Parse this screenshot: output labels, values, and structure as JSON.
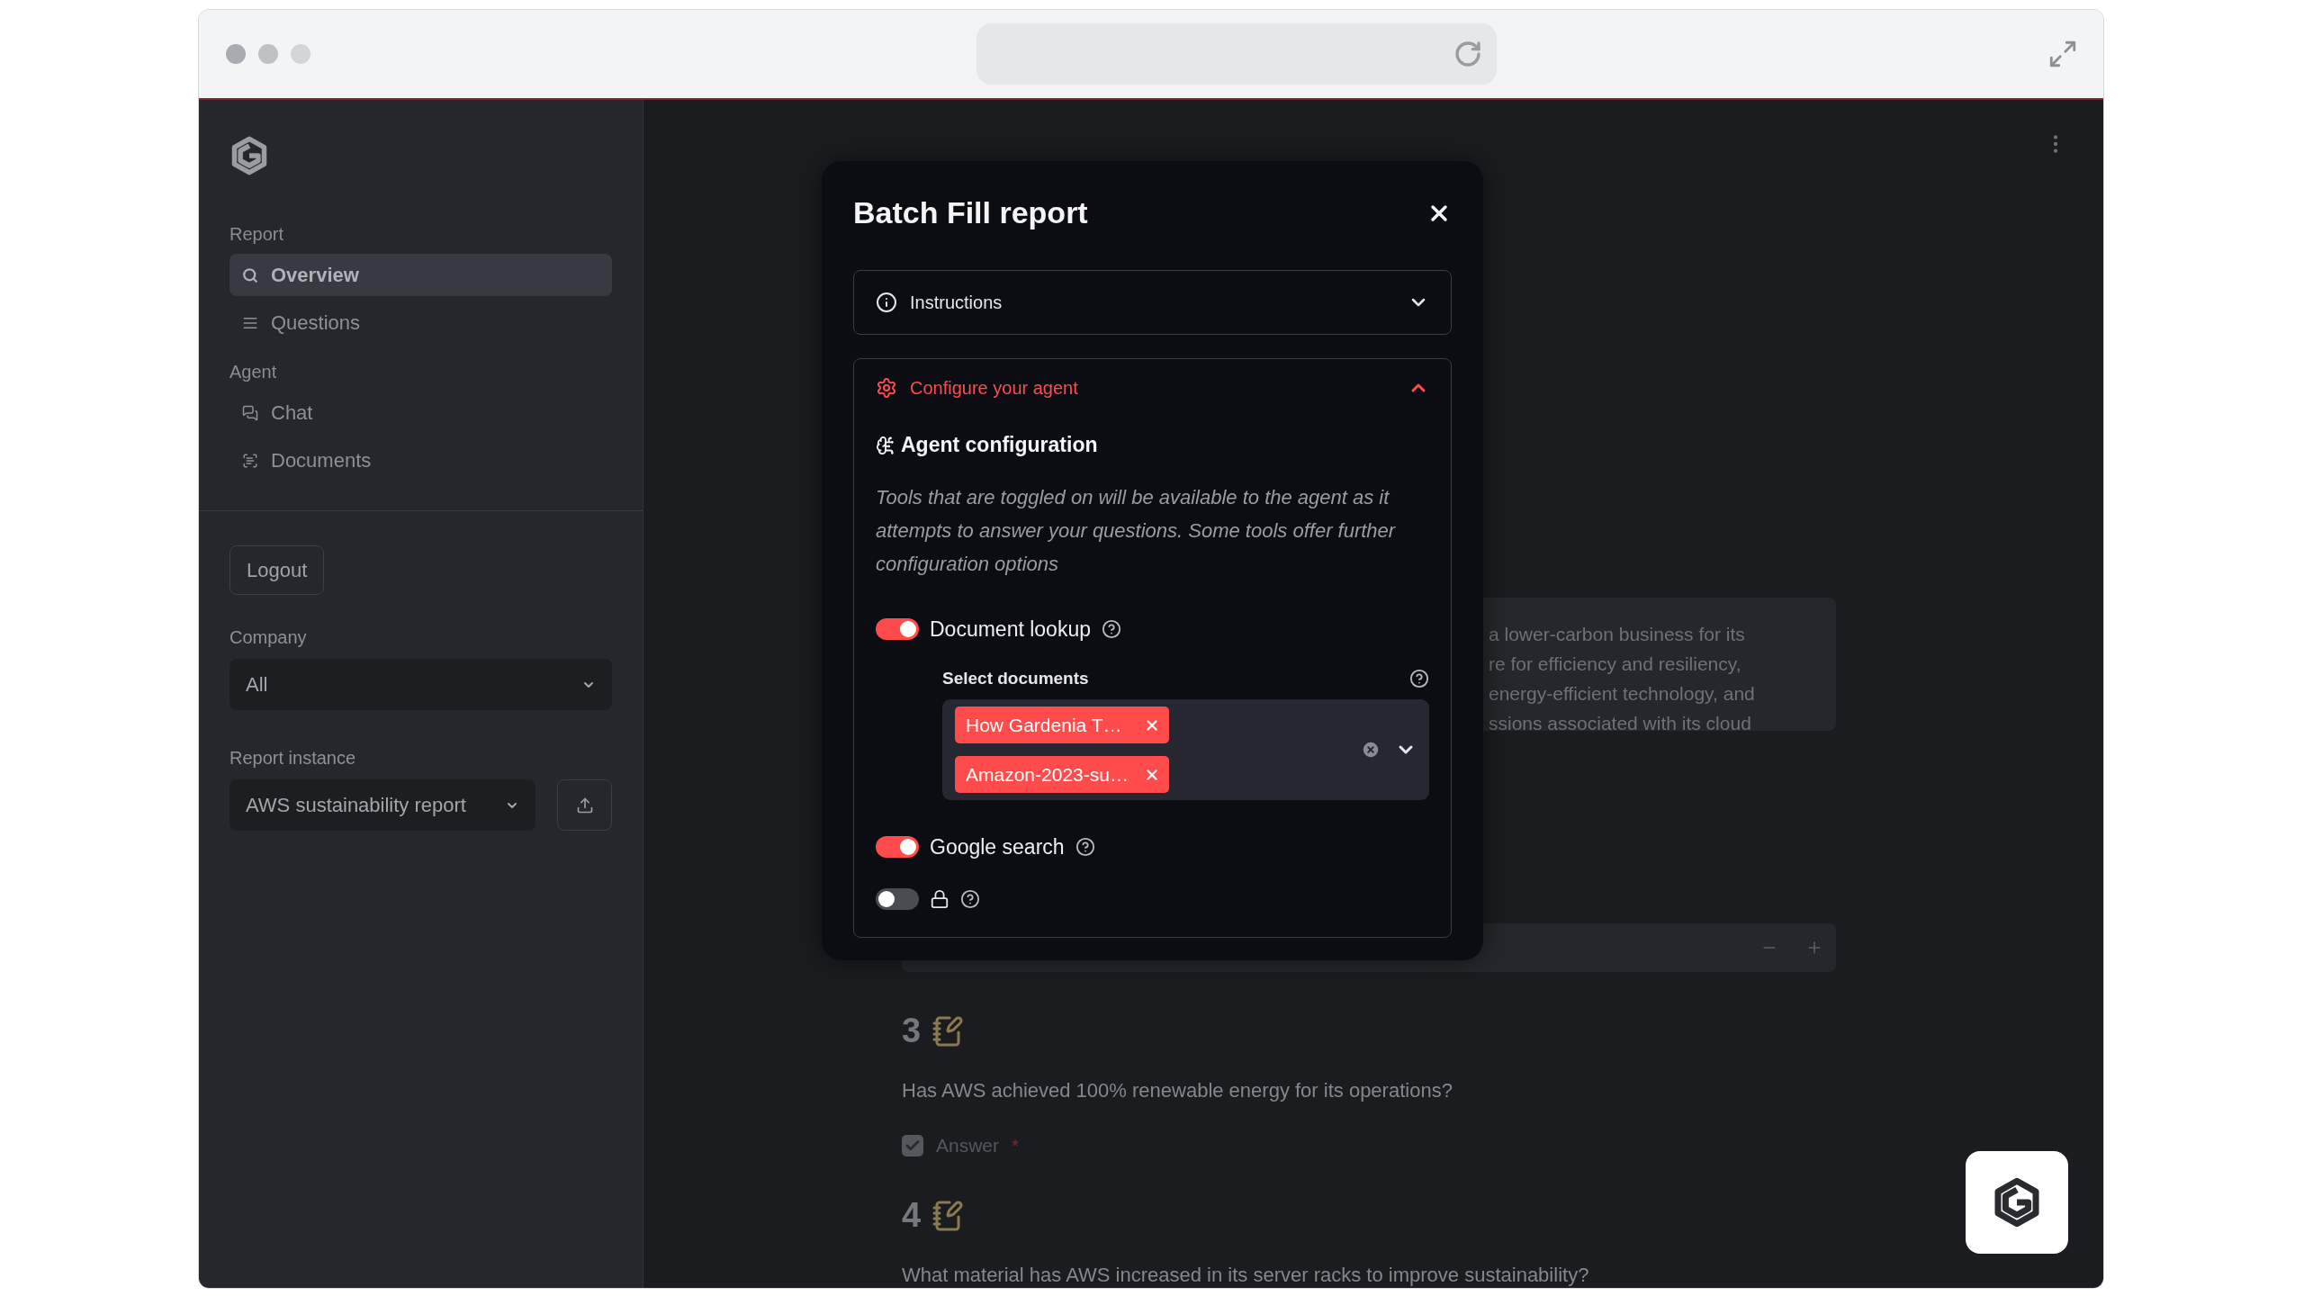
{
  "sidebar": {
    "sections": [
      {
        "label": "Report",
        "items": [
          {
            "label": "Overview",
            "selected": true
          },
          {
            "label": "Questions",
            "selected": false
          }
        ]
      },
      {
        "label": "Agent",
        "items": [
          {
            "label": "Chat",
            "selected": false
          },
          {
            "label": "Documents",
            "selected": false
          }
        ]
      }
    ],
    "logout": "Logout",
    "company": {
      "label": "Company",
      "value": "All"
    },
    "report_instance": {
      "label": "Report instance",
      "value": "AWS sustainability report"
    }
  },
  "main": {
    "text_lines": [
      "a lower-carbon business for its",
      "re for efficiency and resiliency,",
      "energy-efficient technology, and",
      "ssions associated with its cloud"
    ],
    "questions": [
      {
        "number": "3",
        "text": "Has AWS achieved 100% renewable energy for its operations?",
        "answer_label": "Answer",
        "required_mark": "*",
        "answer_checked": true
      },
      {
        "number": "4",
        "text": "What material has AWS increased in its server racks to improve sustainability?"
      }
    ]
  },
  "modal": {
    "title": "Batch Fill report",
    "sections": [
      {
        "title": "Instructions",
        "expanded": false
      },
      {
        "title": "Configure your agent",
        "expanded": true
      }
    ],
    "config": {
      "heading": "Agent configuration",
      "description": "Tools that are toggled on will be available to the agent as it attempts to answer your questions. Some tools offer further configuration options",
      "tools": [
        {
          "kind": "documents",
          "label": "Document lookup",
          "on": true,
          "select_label": "Select documents",
          "selected_documents": [
            "How Gardenia T…",
            "Amazon-2023-su…"
          ]
        },
        {
          "kind": "plain",
          "label": "Google search",
          "on": true
        },
        {
          "kind": "locked",
          "on": false
        }
      ]
    }
  }
}
